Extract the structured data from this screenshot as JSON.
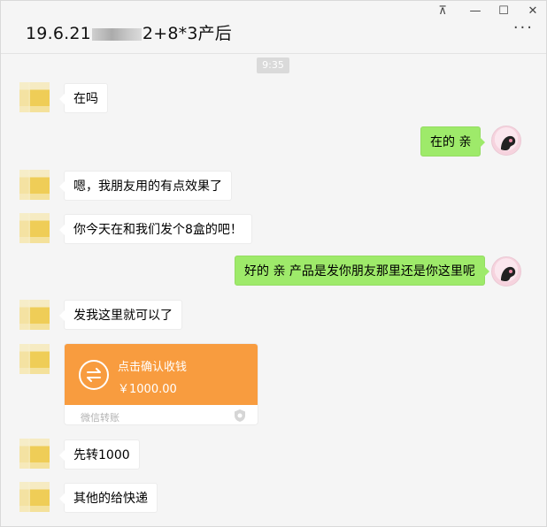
{
  "window": {
    "title_prefix": "19.6.21",
    "title_suffix": "2+8*3产后",
    "controls": {
      "pin": "⊼",
      "minimize": "—",
      "maximize": "☐",
      "close": "✕"
    },
    "more_label": "···"
  },
  "timestamp": "9:35",
  "messages": [
    {
      "side": "left",
      "text": "在吗"
    },
    {
      "side": "right",
      "text": "在的 亲"
    },
    {
      "side": "left",
      "text": "嗯，我朋友用的有点效果了"
    },
    {
      "side": "left",
      "text": "你今天在和我们发个8盒的吧！"
    },
    {
      "side": "right",
      "text": "好的 亲 产品是发你朋友那里还是你这里呢"
    },
    {
      "side": "left",
      "text": "发我这里就可以了"
    },
    {
      "side": "left",
      "text": "先转1000"
    },
    {
      "side": "left",
      "text": "其他的给快递"
    }
  ],
  "transfer": {
    "status": "点击确认收钱",
    "amount": "￥1000.00",
    "footer": "微信转账",
    "icon": "transfer-arrows-icon",
    "accent": "#f89c3f"
  },
  "colors": {
    "my_bubble": "#9eea6a",
    "their_bubble": "#ffffff",
    "background": "#f5f5f5"
  }
}
